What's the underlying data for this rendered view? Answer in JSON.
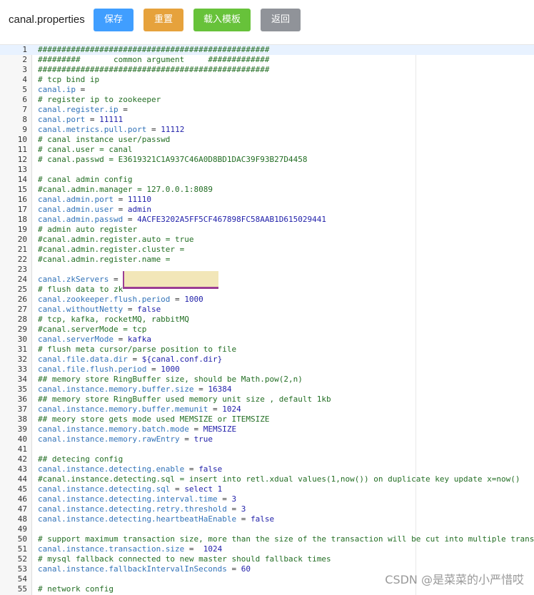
{
  "toolbar": {
    "file_name": "canal.properties",
    "save_label": "保存",
    "reset_label": "重置",
    "load_template_label": "载入模板",
    "back_label": "返回",
    "colors": {
      "save": "#409eff",
      "reset": "#e6a23c",
      "template": "#67c23a",
      "back": "#909399"
    }
  },
  "editor": {
    "lines": [
      {
        "n": "1",
        "t": "comment",
        "text": "#################################################"
      },
      {
        "n": "2",
        "t": "comment",
        "text": "#########       common argument     #############"
      },
      {
        "n": "3",
        "t": "comment",
        "text": "#################################################"
      },
      {
        "n": "4",
        "t": "comment",
        "text": "# tcp bind ip"
      },
      {
        "n": "5",
        "t": "kv",
        "k": "canal.ip",
        "v": ""
      },
      {
        "n": "6",
        "t": "comment",
        "text": "# register ip to zookeeper"
      },
      {
        "n": "7",
        "t": "kv",
        "k": "canal.register.ip",
        "v": ""
      },
      {
        "n": "8",
        "t": "kv",
        "k": "canal.port",
        "v": "11111"
      },
      {
        "n": "9",
        "t": "kv",
        "k": "canal.metrics.pull.port",
        "v": "11112"
      },
      {
        "n": "10",
        "t": "comment",
        "text": "# canal instance user/passwd"
      },
      {
        "n": "11",
        "t": "comment",
        "text": "# canal.user = canal"
      },
      {
        "n": "12",
        "t": "comment",
        "text": "# canal.passwd = E3619321C1A937C46A0D8BD1DAC39F93B27D4458"
      },
      {
        "n": "13",
        "t": "blank",
        "text": ""
      },
      {
        "n": "14",
        "t": "comment",
        "text": "# canal admin config"
      },
      {
        "n": "15",
        "t": "comment",
        "text": "#canal.admin.manager = 127.0.0.1:8089"
      },
      {
        "n": "16",
        "t": "kv",
        "k": "canal.admin.port",
        "v": "11110"
      },
      {
        "n": "17",
        "t": "kv",
        "k": "canal.admin.user",
        "v": "admin"
      },
      {
        "n": "18",
        "t": "kv",
        "k": "canal.admin.passwd",
        "v": "4ACFE3202A5FF5CF467898FC58AAB1D615029441"
      },
      {
        "n": "19",
        "t": "comment",
        "text": "# admin auto register"
      },
      {
        "n": "20",
        "t": "comment",
        "text": "#canal.admin.register.auto = true"
      },
      {
        "n": "21",
        "t": "comment",
        "text": "#canal.admin.register.cluster ="
      },
      {
        "n": "22",
        "t": "comment",
        "text": "#canal.admin.register.name ="
      },
      {
        "n": "23",
        "t": "blank",
        "text": ""
      },
      {
        "n": "24",
        "t": "kv",
        "k": "canal.zkServers",
        "v": ""
      },
      {
        "n": "25",
        "t": "comment",
        "text": "# flush data to zk"
      },
      {
        "n": "26",
        "t": "kv",
        "k": "canal.zookeeper.flush.period",
        "v": "1000"
      },
      {
        "n": "27",
        "t": "kv",
        "k": "canal.withoutNetty",
        "v": "false"
      },
      {
        "n": "28",
        "t": "comment",
        "text": "# tcp, kafka, rocketMQ, rabbitMQ"
      },
      {
        "n": "29",
        "t": "comment",
        "text": "#canal.serverMode = tcp"
      },
      {
        "n": "30",
        "t": "kv",
        "k": "canal.serverMode",
        "v": "kafka"
      },
      {
        "n": "31",
        "t": "comment",
        "text": "# flush meta cursor/parse position to file"
      },
      {
        "n": "32",
        "t": "kv",
        "k": "canal.file.data.dir",
        "v": "${canal.conf.dir}"
      },
      {
        "n": "33",
        "t": "kv",
        "k": "canal.file.flush.period",
        "v": "1000"
      },
      {
        "n": "34",
        "t": "comment",
        "text": "## memory store RingBuffer size, should be Math.pow(2,n)"
      },
      {
        "n": "35",
        "t": "kv",
        "k": "canal.instance.memory.buffer.size",
        "v": "16384"
      },
      {
        "n": "36",
        "t": "comment",
        "text": "## memory store RingBuffer used memory unit size , default 1kb"
      },
      {
        "n": "37",
        "t": "kv",
        "k": "canal.instance.memory.buffer.memunit",
        "v": "1024"
      },
      {
        "n": "38",
        "t": "comment",
        "text": "## meory store gets mode used MEMSIZE or ITEMSIZE"
      },
      {
        "n": "39",
        "t": "kv",
        "k": "canal.instance.memory.batch.mode",
        "v": "MEMSIZE"
      },
      {
        "n": "40",
        "t": "kv",
        "k": "canal.instance.memory.rawEntry",
        "v": "true"
      },
      {
        "n": "41",
        "t": "blank",
        "text": ""
      },
      {
        "n": "42",
        "t": "comment",
        "text": "## detecing config"
      },
      {
        "n": "43",
        "t": "kv",
        "k": "canal.instance.detecting.enable",
        "v": "false"
      },
      {
        "n": "44",
        "t": "comment",
        "text": "#canal.instance.detecting.sql = insert into retl.xdual values(1,now()) on duplicate key update x=now()"
      },
      {
        "n": "45",
        "t": "kv",
        "k": "canal.instance.detecting.sql",
        "v": "select 1"
      },
      {
        "n": "46",
        "t": "kv",
        "k": "canal.instance.detecting.interval.time",
        "v": "3"
      },
      {
        "n": "47",
        "t": "kv",
        "k": "canal.instance.detecting.retry.threshold",
        "v": "3"
      },
      {
        "n": "48",
        "t": "kv",
        "k": "canal.instance.detecting.heartbeatHaEnable",
        "v": "false"
      },
      {
        "n": "49",
        "t": "blank",
        "text": ""
      },
      {
        "n": "50",
        "t": "comment",
        "text": "# support maximum transaction size, more than the size of the transaction will be cut into multiple transactions delivery"
      },
      {
        "n": "51",
        "t": "kv",
        "k": "canal.instance.transaction.size",
        "v": " 1024"
      },
      {
        "n": "52",
        "t": "comment",
        "text": "# mysql fallback connected to new master should fallback times"
      },
      {
        "n": "53",
        "t": "kv",
        "k": "canal.instance.fallbackIntervalInSeconds",
        "v": "60"
      },
      {
        "n": "54",
        "t": "blank",
        "text": ""
      },
      {
        "n": "55",
        "t": "comment",
        "text": "# network config"
      }
    ]
  },
  "watermark": "CSDN @是菜菜的小严惜哎"
}
